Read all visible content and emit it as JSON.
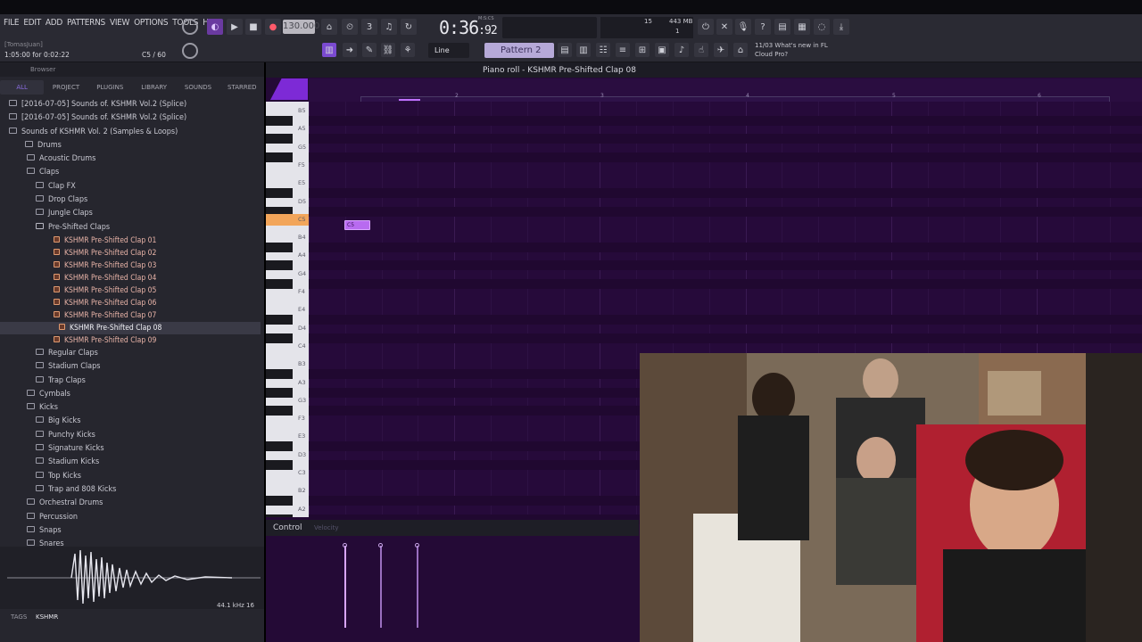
{
  "menu": [
    "FILE",
    "EDIT",
    "ADD",
    "PATTERNS",
    "VIEW",
    "OPTIONS",
    "TOOLS",
    "HELP"
  ],
  "hint": {
    "user": "[TomasJuan]",
    "time": "1:05:00 for 0:02:22",
    "note": "C5 / 60"
  },
  "transport": {
    "tempo": "130.000",
    "time_main": "0:36",
    "time_frac": ":92",
    "mscs": "M:S:CS"
  },
  "meters": {
    "cpu": "15",
    "memory": "443 MB",
    "polyphony": "1"
  },
  "snap": {
    "label": "Line"
  },
  "pattern": {
    "label": "Pattern 2"
  },
  "news": {
    "line1": "11/03  What's new in FL",
    "line2": "Cloud Pro?"
  },
  "browser": {
    "title": "Browser",
    "tabs": [
      "ALL",
      "PROJECT",
      "PLUGINS",
      "LIBRARY",
      "SOUNDS",
      "STARRED"
    ],
    "tree": [
      {
        "label": "[2016-07-05] Sounds of. KSHMR Vol.2 (Splice)",
        "indent": 0,
        "type": "folder"
      },
      {
        "label": "[2016-07-05] Sounds of. KSHMR Vol.2 (Splice)",
        "indent": 0,
        "type": "folder"
      },
      {
        "label": "Sounds of KSHMR Vol. 2 (Samples & Loops)",
        "indent": 1,
        "type": "folder"
      },
      {
        "label": "Drums",
        "indent": 2,
        "type": "folder"
      },
      {
        "label": "Acoustic Drums",
        "indent": 3,
        "type": "folder"
      },
      {
        "label": "Claps",
        "indent": 3,
        "type": "folder"
      },
      {
        "label": "Clap FX",
        "indent": 4,
        "type": "folder"
      },
      {
        "label": "Drop Claps",
        "indent": 4,
        "type": "folder"
      },
      {
        "label": "Jungle Claps",
        "indent": 4,
        "type": "folder"
      },
      {
        "label": "Pre-Shifted Claps",
        "indent": 4,
        "type": "folder",
        "open": true
      },
      {
        "label": "KSHMR Pre-Shifted Clap 01",
        "indent": 5,
        "type": "file"
      },
      {
        "label": "KSHMR Pre-Shifted Clap 02",
        "indent": 5,
        "type": "file"
      },
      {
        "label": "KSHMR Pre-Shifted Clap 03",
        "indent": 5,
        "type": "file"
      },
      {
        "label": "KSHMR Pre-Shifted Clap 04",
        "indent": 5,
        "type": "file"
      },
      {
        "label": "KSHMR Pre-Shifted Clap 05",
        "indent": 5,
        "type": "file"
      },
      {
        "label": "KSHMR Pre-Shifted Clap 06",
        "indent": 5,
        "type": "file"
      },
      {
        "label": "KSHMR Pre-Shifted Clap 07",
        "indent": 5,
        "type": "file"
      },
      {
        "label": "KSHMR Pre-Shifted Clap 08",
        "indent": 6,
        "type": "file",
        "selected": true
      },
      {
        "label": "KSHMR Pre-Shifted Clap 09",
        "indent": 5,
        "type": "file"
      },
      {
        "label": "Regular Claps",
        "indent": 4,
        "type": "folder"
      },
      {
        "label": "Stadium Claps",
        "indent": 4,
        "type": "folder"
      },
      {
        "label": "Trap Claps",
        "indent": 4,
        "type": "folder"
      },
      {
        "label": "Cymbals",
        "indent": 3,
        "type": "folder"
      },
      {
        "label": "Kicks",
        "indent": 3,
        "type": "folder"
      },
      {
        "label": "Big Kicks",
        "indent": 4,
        "type": "folder"
      },
      {
        "label": "Punchy Kicks",
        "indent": 4,
        "type": "folder"
      },
      {
        "label": "Signature Kicks",
        "indent": 4,
        "type": "folder"
      },
      {
        "label": "Stadium Kicks",
        "indent": 4,
        "type": "folder"
      },
      {
        "label": "Top Kicks",
        "indent": 4,
        "type": "folder"
      },
      {
        "label": "Trap and 808 Kicks",
        "indent": 4,
        "type": "folder"
      },
      {
        "label": "Orchestral Drums",
        "indent": 3,
        "type": "folder"
      },
      {
        "label": "Percussion",
        "indent": 3,
        "type": "folder"
      },
      {
        "label": "Snaps",
        "indent": 3,
        "type": "folder"
      },
      {
        "label": "Snares",
        "indent": 3,
        "type": "folder"
      }
    ],
    "sample_info": "44.1 kHz 16",
    "tags_label": "TAGS",
    "tags_value": "KSHMR"
  },
  "pianoroll": {
    "title": "Piano roll - KSHMR Pre-Shifted Clap 08",
    "ruler": [
      "2",
      "3",
      "4",
      "5",
      "6"
    ],
    "keys": [
      "B5",
      "A5",
      "G5",
      "F5",
      "E5",
      "D5",
      "C5",
      "B4",
      "A4",
      "G4",
      "F4",
      "E4",
      "D4",
      "C4",
      "B3",
      "A3",
      "G3",
      "F3",
      "E3",
      "D3",
      "C3",
      "B2",
      "A2"
    ],
    "note_label": "C5",
    "control_label": "Control",
    "control_sub": "Velocity"
  },
  "colors": {
    "accent": "#8a3cf0",
    "grid_bg": "#260a3a",
    "note": "#b86bf0"
  }
}
